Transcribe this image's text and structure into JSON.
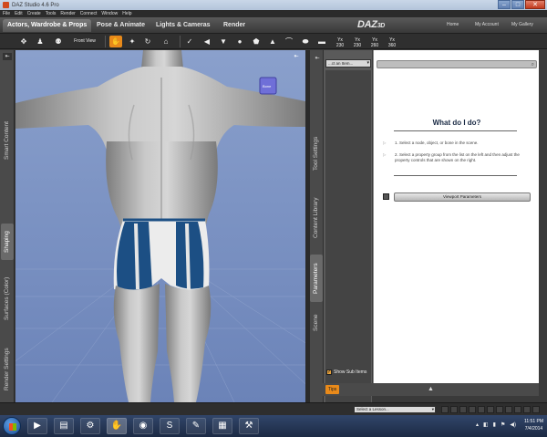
{
  "window": {
    "title": "DAZ Studio 4.6 Pro",
    "buttons": [
      "–",
      "□",
      "✕"
    ]
  },
  "menu": [
    "File",
    "Edit",
    "Create",
    "Tools",
    "Render",
    "Connect",
    "Window",
    "Help"
  ],
  "header": {
    "tabs": [
      {
        "label": "Actors, Wardrobe & Props",
        "active": true
      },
      {
        "label": "Pose & Animate",
        "active": false
      },
      {
        "label": "Lights & Cameras",
        "active": false
      },
      {
        "label": "Render",
        "active": false
      }
    ],
    "logo": "DAZ",
    "logo_suffix": "3D",
    "links": [
      "Home",
      "My Account",
      "My Gallery"
    ]
  },
  "toolbar": {
    "front_view_label": "Front View",
    "quick_labels": [
      "Yx 230",
      "Yx 230",
      "Yx 260",
      "Yx 360"
    ]
  },
  "left_tabs": [
    "Smart Content",
    "Shaping",
    "Surfaces (Color)",
    "Render Settings"
  ],
  "right_tabs": [
    "Tool Settings",
    "Content Library",
    "Parameters",
    "Scene"
  ],
  "property": {
    "dropdown": "...ct an Item...",
    "show_sub_items": "Show Sub Items"
  },
  "tips": {
    "title": "What do I do?",
    "steps": [
      "1. Select a node, object, or bone in the scene.",
      "2. Select a property group from the list on the left and then adjust the property controls that are shown on the right."
    ],
    "button": "Viewport Parameters",
    "tips_button": "Tips"
  },
  "viewport": {
    "badge": "Bone"
  },
  "lesson": {
    "dropdown": "Select a Lesson..."
  },
  "taskbar": {
    "clock_time": "11:51 PM",
    "clock_date": "7/4/2014"
  },
  "colors": {
    "accent": "#e98a1a",
    "viewport_bg": "#7f94c2",
    "brief_blue": "#1c4f84"
  }
}
